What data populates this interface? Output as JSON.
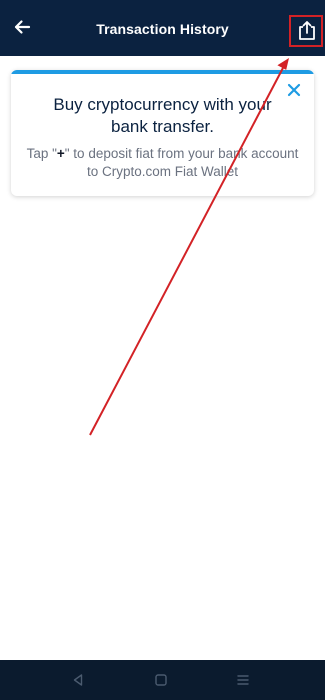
{
  "header": {
    "title": "Transaction History",
    "back_icon": "arrow-left-icon",
    "export_icon": "share-export-icon"
  },
  "banner": {
    "heading": "Buy cryptocurrency with your bank transfer.",
    "body_prefix": "Tap \"",
    "body_plus": "+",
    "body_suffix": "\" to deposit fiat from your bank account to Crypto.com Fiat Wallet",
    "close_icon": "close-icon",
    "accent_color": "#1e9be3"
  },
  "navbar": {
    "items": [
      "back-triangle-icon",
      "home-square-icon",
      "menu-lines-icon"
    ]
  },
  "annotation": {
    "color": "#d32226",
    "target": "export-button"
  },
  "colors": {
    "header_bg": "#0b2240",
    "navbar_bg": "#0b1b2e",
    "heading_text": "#0b2240",
    "body_text": "#6b7280"
  }
}
